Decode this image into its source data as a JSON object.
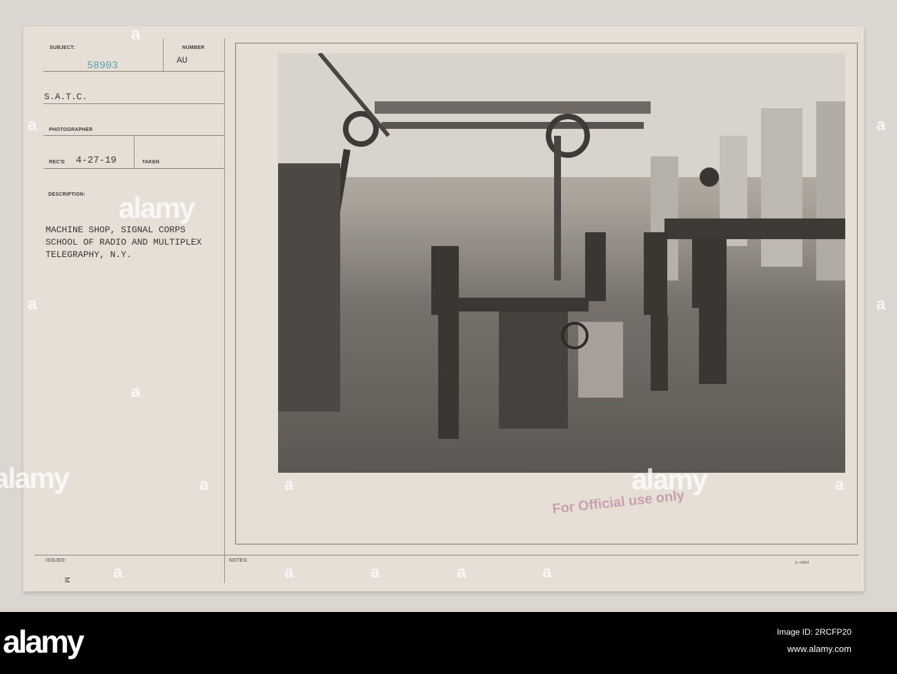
{
  "form": {
    "subject_label": "SUBJECT:",
    "subject_value": "58903",
    "number_label": "NUMBER",
    "number_value": "AU",
    "unit": "S.A.T.C.",
    "photographer_label": "PHOTOGRAPHER",
    "recd_label": "REC'D",
    "recd_value": "4-27-19",
    "taken_label": "TAKEN",
    "description_label": "DESCRIPTION:",
    "description_lines": [
      "MACHINE SHOP, SIGNAL CORPS",
      "SCHOOL OF RADIO AND MULTIPLEX",
      "TELEGRAPHY, N.Y."
    ],
    "issued_label": "ISSUED:",
    "notes_label": "NOTES:",
    "margin_mark": "M",
    "form_code": "3—5603"
  },
  "stamp": "For Official use only",
  "watermark": {
    "brand": "alamy",
    "letter": "a"
  },
  "footer": {
    "logo": "alamy",
    "image_id": "Image ID: 2RCFP20",
    "url": "www.alamy.com"
  }
}
